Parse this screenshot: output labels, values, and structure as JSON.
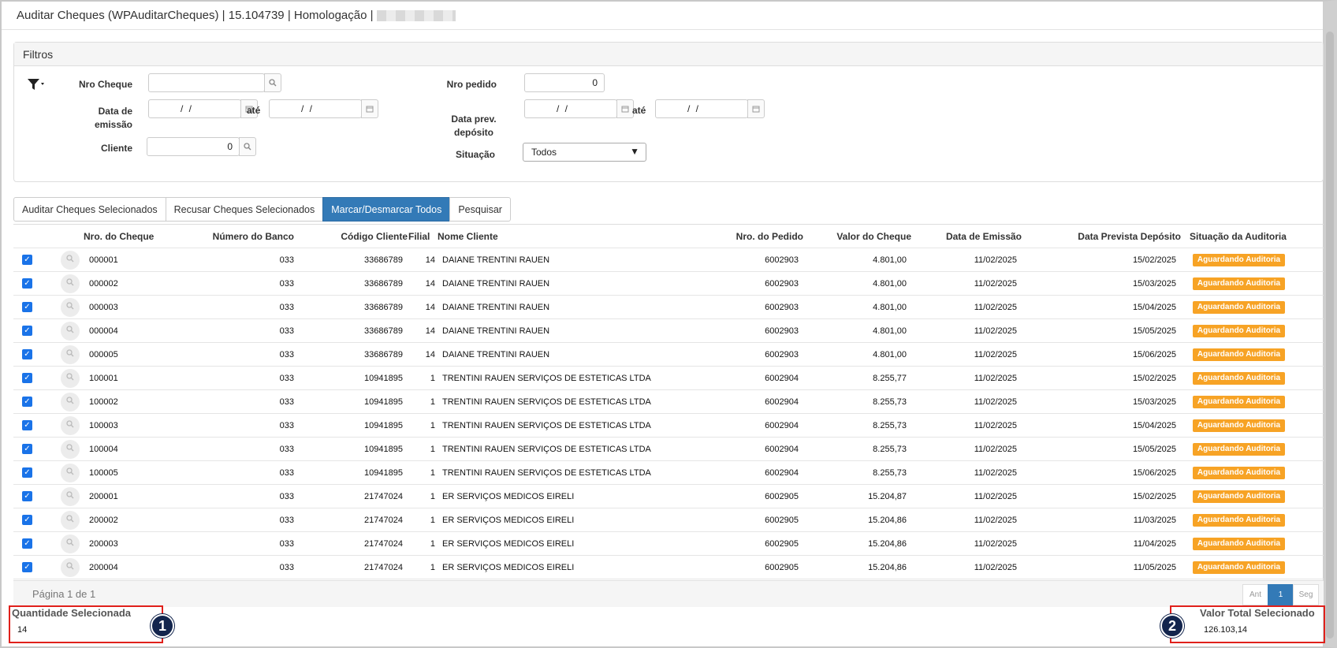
{
  "window": {
    "title": "Auditar Cheques (WPAuditarCheques) | 15.104739 | Homologação |"
  },
  "filters": {
    "panel_title": "Filtros",
    "nro_cheque_label": "Nro Cheque",
    "nro_cheque_value": "",
    "data_emissao_label": "Data de emissão",
    "data_emissao_from": "/ /",
    "ate_label": "até",
    "data_emissao_to": "/ /",
    "cliente_label": "Cliente",
    "cliente_value": "0",
    "nro_pedido_label": "Nro pedido",
    "nro_pedido_value": "0",
    "data_prev_label": "Data prev. depósito",
    "data_prev_from": "/ /",
    "ate_label_2": "até",
    "data_prev_to": "/ /",
    "situacao_label": "Situação",
    "situacao_value": "Todos"
  },
  "toolbar": {
    "auditar_label": "Auditar Cheques Selecionados",
    "recusar_label": "Recusar Cheques Selecionados",
    "marcar_label": "Marcar/Desmarcar Todos",
    "pesquisar_label": "Pesquisar"
  },
  "table": {
    "columns": [
      "Nro. do Cheque",
      "Número do Banco",
      "Código Cliente",
      "Filial",
      "Nome Cliente",
      "Nro. do Pedido",
      "Valor do Cheque",
      "Data de Emissão",
      "Data Prevista Depósito",
      "Situação da Auditoria"
    ],
    "rows": [
      [
        "000001",
        "033",
        "33686789",
        "14",
        "DAIANE TRENTINI RAUEN",
        "6002903",
        "4.801,00",
        "11/02/2025",
        "15/02/2025",
        "Aguardando Auditoria"
      ],
      [
        "000002",
        "033",
        "33686789",
        "14",
        "DAIANE TRENTINI RAUEN",
        "6002903",
        "4.801,00",
        "11/02/2025",
        "15/03/2025",
        "Aguardando Auditoria"
      ],
      [
        "000003",
        "033",
        "33686789",
        "14",
        "DAIANE TRENTINI RAUEN",
        "6002903",
        "4.801,00",
        "11/02/2025",
        "15/04/2025",
        "Aguardando Auditoria"
      ],
      [
        "000004",
        "033",
        "33686789",
        "14",
        "DAIANE TRENTINI RAUEN",
        "6002903",
        "4.801,00",
        "11/02/2025",
        "15/05/2025",
        "Aguardando Auditoria"
      ],
      [
        "000005",
        "033",
        "33686789",
        "14",
        "DAIANE TRENTINI RAUEN",
        "6002903",
        "4.801,00",
        "11/02/2025",
        "15/06/2025",
        "Aguardando Auditoria"
      ],
      [
        "100001",
        "033",
        "10941895",
        "1",
        "TRENTINI RAUEN SERVIÇOS DE ESTETICAS LTDA",
        "6002904",
        "8.255,77",
        "11/02/2025",
        "15/02/2025",
        "Aguardando Auditoria"
      ],
      [
        "100002",
        "033",
        "10941895",
        "1",
        "TRENTINI RAUEN SERVIÇOS DE ESTETICAS LTDA",
        "6002904",
        "8.255,73",
        "11/02/2025",
        "15/03/2025",
        "Aguardando Auditoria"
      ],
      [
        "100003",
        "033",
        "10941895",
        "1",
        "TRENTINI RAUEN SERVIÇOS DE ESTETICAS LTDA",
        "6002904",
        "8.255,73",
        "11/02/2025",
        "15/04/2025",
        "Aguardando Auditoria"
      ],
      [
        "100004",
        "033",
        "10941895",
        "1",
        "TRENTINI RAUEN SERVIÇOS DE ESTETICAS LTDA",
        "6002904",
        "8.255,73",
        "11/02/2025",
        "15/05/2025",
        "Aguardando Auditoria"
      ],
      [
        "100005",
        "033",
        "10941895",
        "1",
        "TRENTINI RAUEN SERVIÇOS DE ESTETICAS LTDA",
        "6002904",
        "8.255,73",
        "11/02/2025",
        "15/06/2025",
        "Aguardando Auditoria"
      ],
      [
        "200001",
        "033",
        "21747024",
        "1",
        "ER SERVIÇOS MEDICOS EIRELI",
        "6002905",
        "15.204,87",
        "11/02/2025",
        "15/02/2025",
        "Aguardando Auditoria"
      ],
      [
        "200002",
        "033",
        "21747024",
        "1",
        "ER SERVIÇOS MEDICOS EIRELI",
        "6002905",
        "15.204,86",
        "11/02/2025",
        "11/03/2025",
        "Aguardando Auditoria"
      ],
      [
        "200003",
        "033",
        "21747024",
        "1",
        "ER SERVIÇOS MEDICOS EIRELI",
        "6002905",
        "15.204,86",
        "11/02/2025",
        "11/04/2025",
        "Aguardando Auditoria"
      ],
      [
        "200004",
        "033",
        "21747024",
        "1",
        "ER SERVIÇOS MEDICOS EIRELI",
        "6002905",
        "15.204,86",
        "11/02/2025",
        "11/05/2025",
        "Aguardando Auditoria"
      ]
    ]
  },
  "pagination": {
    "info": "Página 1 de 1",
    "prev_label": "Ant",
    "current": "1",
    "next_label": "Seg"
  },
  "summary": {
    "quantidade_label": "Quantidade Selecionada",
    "quantidade_value": "14",
    "valor_label": "Valor Total Selecionado",
    "valor_value": "126.103,14"
  },
  "annotations": {
    "marker_1": "1",
    "marker_2": "2",
    "highlight_color": "#e0201b",
    "marker_color": "#13254d"
  },
  "colors": {
    "primary": "#337ab7",
    "status_badge": "#f7a325",
    "checkbox": "#1a73e8"
  }
}
